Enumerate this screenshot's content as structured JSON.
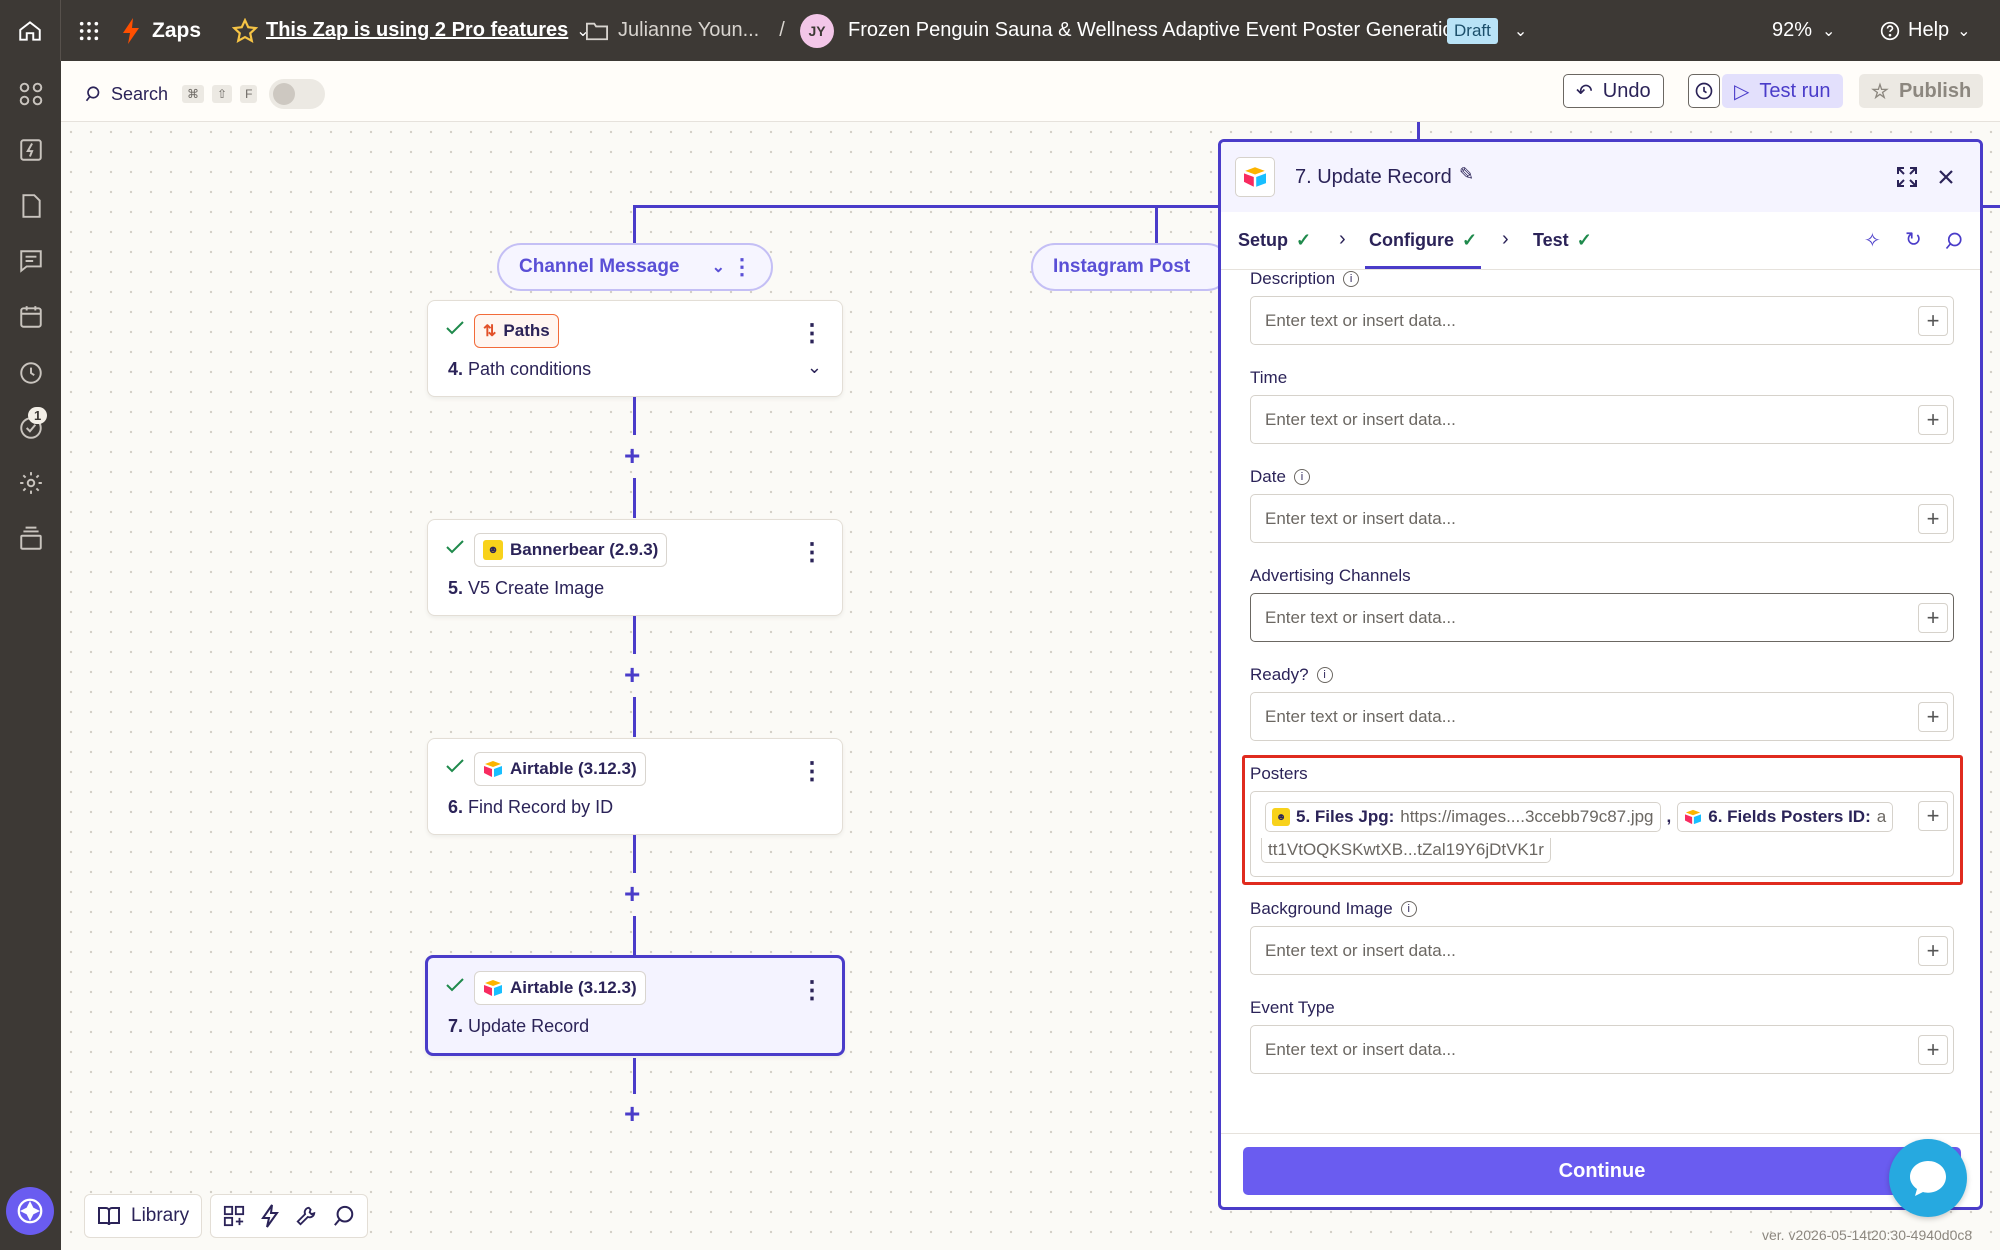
{
  "topbar": {
    "app_name": "Zaps",
    "pro_notice": "This Zap is using 2 Pro features",
    "folder": "Julianne Youn...",
    "separator": "/",
    "avatar_initials": "JY",
    "zap_title": "Frozen Penguin Sauna & Wellness Adaptive Event Poster Generation",
    "status_badge": "Draft",
    "zoom": "92%",
    "help": "Help"
  },
  "leftbar": {
    "notification_count": "1"
  },
  "subbar": {
    "search_label": "Search",
    "shortcut_keys": [
      "⌘",
      "⇧",
      "F"
    ],
    "undo": "Undo",
    "test_run": "Test run",
    "publish": "Publish"
  },
  "canvas": {
    "path_pill_1": "Channel Message",
    "path_pill_2": "Instagram Post",
    "nodes": [
      {
        "badge": "Paths",
        "num": "4.",
        "title": "Path conditions"
      },
      {
        "badge": "Bannerbear (2.9.3)",
        "num": "5.",
        "title": "V5 Create Image"
      },
      {
        "badge": "Airtable (3.12.3)",
        "num": "6.",
        "title": "Find Record by ID"
      },
      {
        "badge": "Airtable (3.12.3)",
        "num": "7.",
        "title": "Update Record"
      }
    ]
  },
  "panel": {
    "title": "7. Update Record",
    "tabs": [
      "Setup",
      "Configure",
      "Test"
    ],
    "placeholder": "Enter text or insert data...",
    "fields": [
      {
        "label": "Description"
      },
      {
        "label": "Time"
      },
      {
        "label": "Date"
      },
      {
        "label": "Advertising Channels"
      },
      {
        "label": "Ready?"
      },
      {
        "label": "Posters"
      },
      {
        "label": "Background Image"
      },
      {
        "label": "Event Type"
      }
    ],
    "posters": {
      "chip1_label": "5. Files Jpg:",
      "chip1_value": "https://images....3ccebb79c87.jpg",
      "comma": ",",
      "chip2_label": "6. Fields Posters ID:",
      "chip2_value": "a",
      "chip3_value": "tt1VtOQKSKwtXB...tZal19Y6jDtVK1r"
    },
    "continue": "Continue"
  },
  "bottom": {
    "library": "Library"
  },
  "version": "ver. v2026-05-14t20:30-4940d0c8",
  "colors": {
    "accent": "#4a3cc9",
    "topbar": "#3d3935",
    "highlight": "#e02b1f",
    "bolt": "#ff4f00"
  }
}
